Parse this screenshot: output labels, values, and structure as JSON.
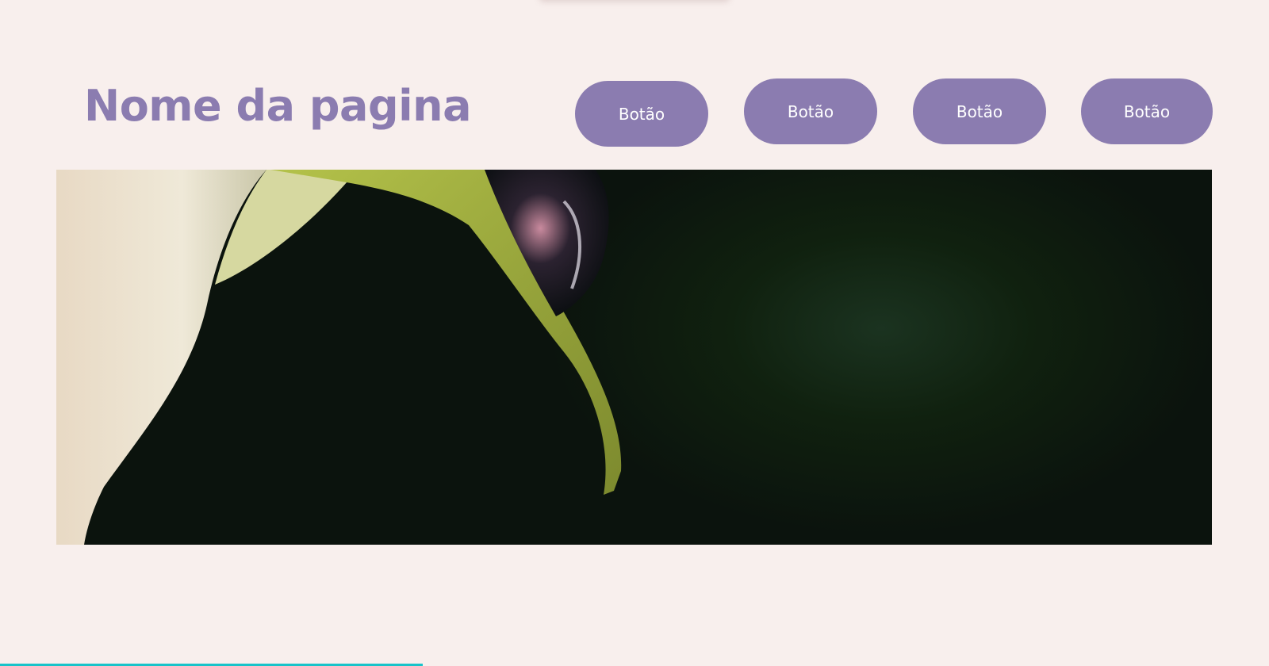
{
  "header": {
    "title": "Nome da pagina"
  },
  "nav": {
    "buttons": [
      {
        "label": "Botão"
      },
      {
        "label": "Botão"
      },
      {
        "label": "Botão"
      },
      {
        "label": "Botão"
      }
    ]
  },
  "hero": {
    "image": "calla-lily-water-drop-photo"
  },
  "progress": {
    "fraction": 0.333
  },
  "colors": {
    "accent": "#8b7cb0",
    "background": "#f8efed",
    "progress": "#18c3c9"
  }
}
